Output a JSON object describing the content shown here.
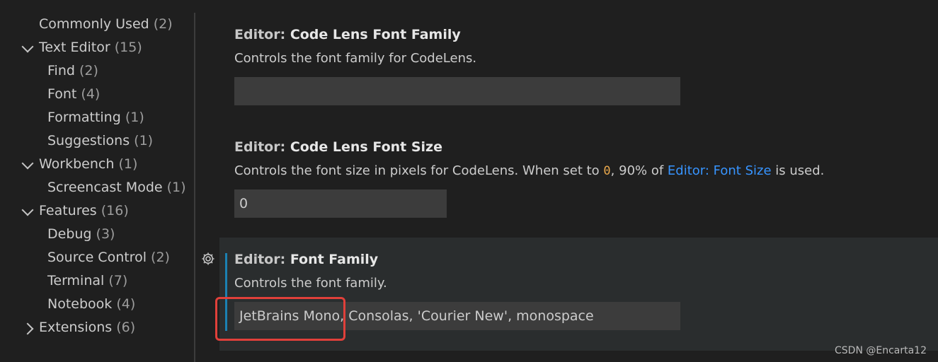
{
  "toc": [
    {
      "label": "Commonly Used",
      "count": "(2)"
    },
    {
      "label": "Text Editor",
      "count": "(15)"
    },
    {
      "label": "Find",
      "count": "(2)"
    },
    {
      "label": "Font",
      "count": "(4)"
    },
    {
      "label": "Formatting",
      "count": "(1)"
    },
    {
      "label": "Suggestions",
      "count": "(1)"
    },
    {
      "label": "Workbench",
      "count": "(1)"
    },
    {
      "label": "Screencast Mode",
      "count": "(1)"
    },
    {
      "label": "Features",
      "count": "(16)"
    },
    {
      "label": "Debug",
      "count": "(3)"
    },
    {
      "label": "Source Control",
      "count": "(2)"
    },
    {
      "label": "Terminal",
      "count": "(7)"
    },
    {
      "label": "Notebook",
      "count": "(4)"
    },
    {
      "label": "Extensions",
      "count": "(6)"
    }
  ],
  "settings": [
    {
      "category": "Editor: ",
      "name": "Code Lens Font Family",
      "description": "Controls the font family for CodeLens.",
      "value": ""
    },
    {
      "category": "Editor: ",
      "name": "Code Lens Font Size",
      "desc_before": "Controls the font size in pixels for CodeLens. When set to ",
      "desc_code": "0",
      "desc_mid": ", 90% of ",
      "desc_link": "Editor: Font Size",
      "desc_after": " is used.",
      "value": "0"
    },
    {
      "category": "Editor: ",
      "name": "Font Family",
      "description": "Controls the font family.",
      "value": "JetBrains Mono, Consolas, 'Courier New', monospace"
    }
  ],
  "watermark": "CSDN @Encarta12",
  "colors": {
    "background": "#1f1f1f",
    "input_background": "#3c3c3c",
    "link": "#3794ff",
    "code": "#e9a84c",
    "focus_indicator": "#1b80b2",
    "annotation": "#e0403a"
  }
}
